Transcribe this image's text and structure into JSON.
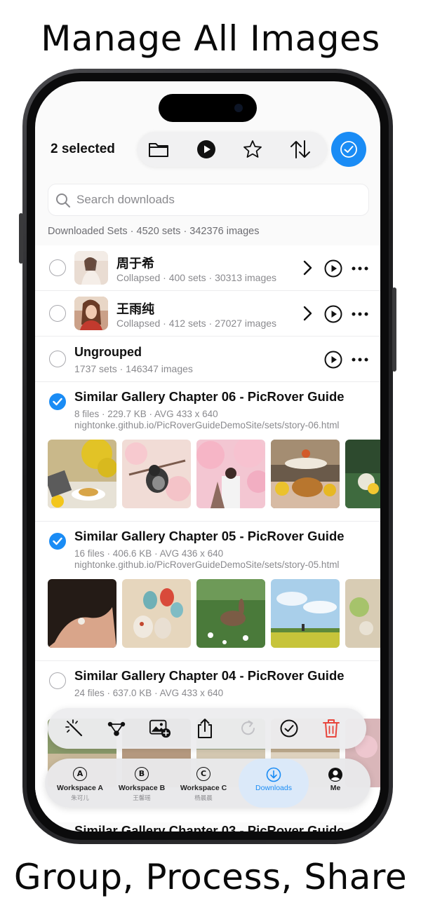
{
  "promo": {
    "headline_top": "Manage All Images",
    "headline_bottom": "Group, Process, Share"
  },
  "header": {
    "selected_label": "2 selected",
    "tools": [
      "folder-icon",
      "play-icon",
      "star-icon",
      "sort-icon"
    ],
    "select_mode_icon": "checkmark-circle-icon",
    "accent": "#1a8cf5"
  },
  "search": {
    "placeholder": "Search downloads"
  },
  "summary": "Downloaded Sets · 4520 sets · 342376 images",
  "groups": [
    {
      "name": "周于希",
      "subtitle": "Collapsed · 400 sets · 30313 images",
      "selected": false
    },
    {
      "name": "王雨纯",
      "subtitle": "Collapsed · 412 sets · 27027 images",
      "selected": false
    },
    {
      "name": "Ungrouped",
      "subtitle": "1737 sets · 146347 images",
      "selected": false
    }
  ],
  "galleries": [
    {
      "title": "Similar Gallery Chapter 06 - PicRover Guide",
      "meta": "8 files · 229.7 KB · AVG 433 x 640",
      "url": "nightonke.github.io/PicRoverGuideDemoSite/sets/story-06.html",
      "selected": true
    },
    {
      "title": "Similar Gallery Chapter 05 - PicRover Guide",
      "meta": "16 files · 406.6 KB · AVG 436 x 640",
      "url": "nightonke.github.io/PicRoverGuideDemoSite/sets/story-05.html",
      "selected": true
    },
    {
      "title": "Similar Gallery Chapter 04 - PicRover Guide",
      "meta": "24 files · 637.0 KB · AVG 433 x 640",
      "url": "",
      "selected": false
    }
  ],
  "next_gallery_title": "Similar Gallery Chapter 03 - PicRover Guide",
  "action_bar": [
    "magic-wand-icon",
    "graph-icon",
    "add-image-icon",
    "share-icon",
    "redo-icon",
    "checkmark-icon",
    "trash-icon"
  ],
  "tabs": [
    {
      "icon": "A",
      "label": "Workspace A",
      "sublabel": "朱可儿",
      "active": false
    },
    {
      "icon": "B",
      "label": "Workspace B",
      "sublabel": "王馨瑶",
      "active": false
    },
    {
      "icon": "C",
      "label": "Workspace C",
      "sublabel": "杨晨晨",
      "active": false
    },
    {
      "icon": "download-icon",
      "label": "Downloads",
      "sublabel": "",
      "active": true
    },
    {
      "icon": "person-icon",
      "label": "Me",
      "sublabel": "",
      "active": false
    }
  ]
}
